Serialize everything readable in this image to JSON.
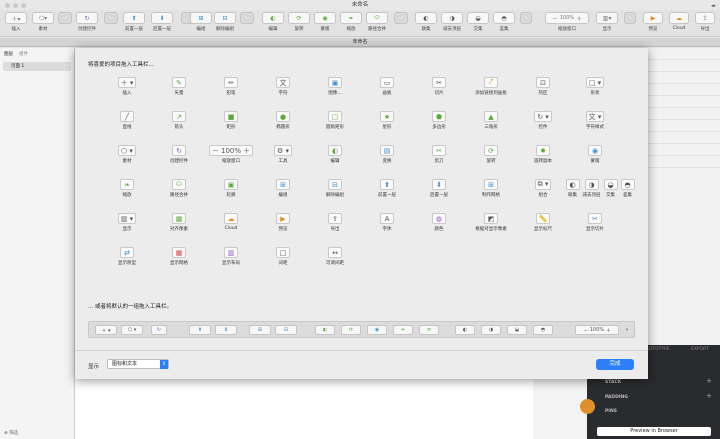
{
  "window": {
    "title": "未命名",
    "doc_tab": "未命名"
  },
  "toolbar": {
    "insert": "插入",
    "assets": "素材",
    "create_symbol": "创建控件",
    "forward": "前置一层",
    "backward": "后置一层",
    "group": "编组",
    "ungroup": "解除编组",
    "edit": "编辑",
    "rotate": "旋转",
    "mask": "蒙版",
    "scale": "缩放",
    "union": "路径合并",
    "combine": "联集",
    "subtract": "减去顶层",
    "intersect": "交集",
    "difference": "差集",
    "zoom_value": "100%",
    "zoom": "缩放窗口",
    "view": "显示",
    "preview": "预览",
    "cloud": "Cloud",
    "export": "导出"
  },
  "left": {
    "tab_layers": "图层",
    "tab_components": "组件",
    "page1": "页面 1",
    "filter": "筛选"
  },
  "sheet": {
    "heading": "将喜爱的项目拖入工具栏...",
    "items": [
      {
        "label": "插入",
        "icon": "＋ ▾"
      },
      {
        "label": "矢量",
        "icon": "✎"
      },
      {
        "label": "铅笔",
        "icon": "✏"
      },
      {
        "label": "字符",
        "icon": "文"
      },
      {
        "label": "图像...",
        "icon": "▣"
      },
      {
        "label": "画板",
        "icon": "▭"
      },
      {
        "label": "切片",
        "icon": "✂"
      },
      {
        "label": "添加链接到画板",
        "icon": "⤤"
      },
      {
        "label": "热区",
        "icon": "⊡"
      },
      {
        "label": "形状",
        "icon": "□ ▾"
      },
      {
        "label": "直线",
        "icon": "╱"
      },
      {
        "label": "箭头",
        "icon": "↗"
      },
      {
        "label": "矩形",
        "icon": "■"
      },
      {
        "label": "椭圆形",
        "icon": "●"
      },
      {
        "label": "圆角矩形",
        "icon": "▢"
      },
      {
        "label": "星形",
        "icon": "★"
      },
      {
        "label": "多边形",
        "icon": "⬟"
      },
      {
        "label": "三角形",
        "icon": "▲"
      },
      {
        "label": "控件",
        "icon": "↻ ▾"
      },
      {
        "label": "字符样式",
        "icon": "文 ▾"
      },
      {
        "label": "素材",
        "icon": "⬡ ▾"
      },
      {
        "label": "创建控件",
        "icon": "↻"
      },
      {
        "label": "缩放窗口",
        "icon": "－ 100% ＋"
      },
      {
        "label": "工具",
        "icon": "⚙ ▾"
      },
      {
        "label": "编辑",
        "icon": "◐"
      },
      {
        "label": "变换",
        "icon": "▤"
      },
      {
        "label": "剪刀",
        "icon": "✂"
      },
      {
        "label": "旋转",
        "icon": "⟳"
      },
      {
        "label": "旋转副本",
        "icon": "✹"
      },
      {
        "label": "蒙版",
        "icon": "◉"
      },
      {
        "label": "缩放",
        "icon": "❧"
      },
      {
        "label": "路径合并",
        "icon": "⬭"
      },
      {
        "label": "轮廓",
        "icon": "▣"
      },
      {
        "label": "编组",
        "icon": "⊞"
      },
      {
        "label": "解除编组",
        "icon": "⊟"
      },
      {
        "label": "前置一层",
        "icon": "⬆"
      },
      {
        "label": "后置一层",
        "icon": "⬇"
      },
      {
        "label": "制作网格",
        "icon": "⊞"
      },
      {
        "label": "组合",
        "icon": "⧉ ▾"
      },
      {
        "label": "联集 减去顶层 交集 差集",
        "icon": "◐ ◑ ◒ ◓"
      },
      {
        "label": "显示",
        "icon": "▥ ▾"
      },
      {
        "label": "对齐像素",
        "icon": "▦"
      },
      {
        "label": "Cloud",
        "icon": "☁"
      },
      {
        "label": "预览",
        "icon": "▶"
      },
      {
        "label": "导出",
        "icon": "⇪"
      },
      {
        "label": "字体",
        "icon": "A"
      },
      {
        "label": "颜色",
        "icon": "◍"
      },
      {
        "label": "根据对显示像素",
        "icon": "◩"
      },
      {
        "label": "显示标尺",
        "icon": "📏"
      },
      {
        "label": "显示切片",
        "icon": "✂"
      },
      {
        "label": "显示原型",
        "icon": "⇄"
      },
      {
        "label": "显示网格",
        "icon": "▦"
      },
      {
        "label": "显示布局",
        "icon": "▥"
      },
      {
        "label": "间距",
        "icon": "□"
      },
      {
        "label": "可调间距",
        "icon": "↔"
      }
    ],
    "boolean": [
      {
        "label": "联集"
      },
      {
        "label": "减去顶层"
      },
      {
        "label": "交集"
      },
      {
        "label": "差集"
      }
    ],
    "default_label": "... 或者将默认的一组拖入工具栏。",
    "default_zoom": "100%",
    "show_label": "显示",
    "show_value": "图标和文本",
    "done": "完成"
  },
  "right": {
    "prototype": "PROTOTYPE",
    "export": "EXPORT",
    "stack": "STACK",
    "padding": "PADDING",
    "pins": "PINS",
    "preview_browser": "Preview in Browser"
  },
  "colors": {
    "accent": "#2d7ff9",
    "green": "#5aaa3a",
    "orange": "#e48b1e"
  }
}
